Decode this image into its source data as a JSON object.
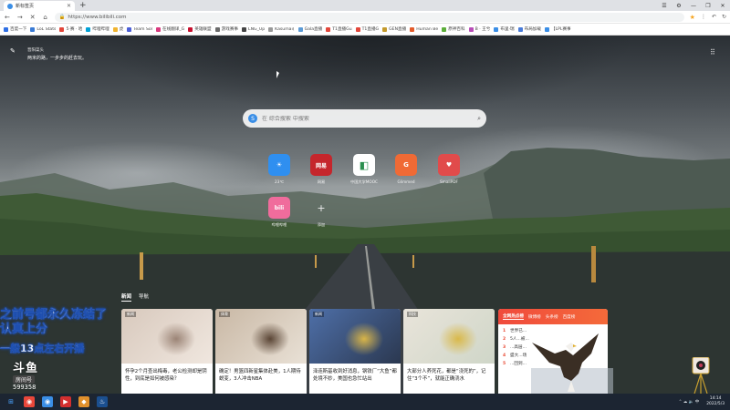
{
  "browser": {
    "tab_title": "新标签页",
    "new_tab_symbol": "+",
    "url": "https://www.bilibili.com",
    "window_controls": [
      "☰",
      "⚙",
      "—",
      "❐",
      "✕"
    ],
    "bookmarks": [
      {
        "label": "百度一下",
        "color": "#2f6fe4"
      },
      {
        "label": "LoL Stats",
        "color": "#3a7bd5"
      },
      {
        "label": "5·赛 · 哈",
        "color": "#e2463a"
      },
      {
        "label": "哔哩哔哩",
        "color": "#00a1d6"
      },
      {
        "label": "虎",
        "color": "#f0b430"
      },
      {
        "label": "Team Sol",
        "color": "#4c5fd7"
      },
      {
        "label": "在线翻译_G",
        "color": "#d93a7e"
      },
      {
        "label": "英雄联盟",
        "color": "#c8102e"
      },
      {
        "label": "游戏赛事",
        "color": "#6b6b6b"
      },
      {
        "label": "LNG_Up",
        "color": "#444"
      },
      {
        "label": "Kasumai(",
        "color": "#999"
      },
      {
        "label": "Gala直播",
        "color": "#5c9bd6"
      },
      {
        "label": "T1直播Gu",
        "color": "#e2463a"
      },
      {
        "label": "T1直播G",
        "color": "#e2463a"
      },
      {
        "label": "GEN直播",
        "color": "#c49a2c"
      },
      {
        "label": "Human Be",
        "color": "#e35b2b"
      },
      {
        "label": "原神百科",
        "color": "#5cae3a"
      },
      {
        "label": "B · 王兮",
        "color": "#b84db8"
      },
      {
        "label": "布里·瑞",
        "color": "#3a8ee6"
      },
      {
        "label": "布局加载",
        "color": "#4a7cd9"
      },
      {
        "label": "【LPL赛事",
        "color": "#3a8ee6"
      }
    ]
  },
  "weather": {
    "title": "晋阳菜头",
    "subtitle": "两米的路，一步步的赶去玩。"
  },
  "search": {
    "placeholder": "在 综合搜索 中搜索"
  },
  "shortcuts": [
    {
      "label": "23℃",
      "glyph": "☀",
      "color": "#2f8ff0"
    },
    {
      "label": "网易",
      "glyph": "网易",
      "color": "#c5262c"
    },
    {
      "label": "中国大学MOOC",
      "glyph": "◧",
      "color": "#ffffff"
    },
    {
      "label": "Glimmed",
      "glyph": "G",
      "color": "#f06a35"
    },
    {
      "label": "SmallPDF",
      "glyph": "♥",
      "color": "#e14b4b"
    },
    {
      "label": "哔哩哔哩",
      "glyph": "bili",
      "color": "#f06c9c"
    },
    {
      "label": "添加",
      "glyph": "+",
      "color": "transparent"
    }
  ],
  "news": {
    "tabs": [
      "新闻",
      "导航"
    ],
    "cards": [
      {
        "tag": "新闻",
        "title": "怀孕2个月查出梅毒，老公检测却是阴性，到底是如何被感染？",
        "palette": [
          "#d8c9bd",
          "#9b8476",
          "#f0e7df"
        ]
      },
      {
        "tag": "体育",
        "title": "确定！男篮四新星集体赴美，1人期待蜕变，3人冲击NBA",
        "palette": [
          "#c9b8a5",
          "#5a4535",
          "#e9e1d6"
        ]
      },
      {
        "tag": "新闻",
        "title": "泽连斯基收到好消息，钢铁厂“大鱼”都处境不妙，美国也急忙站出",
        "palette": [
          "#4e6fa8",
          "#d9b548",
          "#2b3850"
        ]
      },
      {
        "tag": "科技",
        "title": "大部分人养死花，都是“浇死的”，记住“3个不”，就能正确浇水",
        "palette": [
          "#e9e4da",
          "#d9b94a",
          "#cfd6c8"
        ]
      }
    ],
    "hot": {
      "tabs": [
        "全网热点榜",
        "微博榜",
        "头条榜",
        "百度榜"
      ],
      "items": [
        {
          "rank": "1",
          "text": "世界已..."
        },
        {
          "rank": "2",
          "text": "5人...被..."
        },
        {
          "rank": "3",
          "text": "...高层..."
        },
        {
          "rank": "4",
          "text": "盛大...场"
        },
        {
          "rank": "5",
          "text": "...回到..."
        }
      ]
    }
  },
  "overlay": {
    "line1": "之前号都永久冻结了",
    "line2": "认真上分",
    "line3": "一般13点左右开播",
    "brand": "斗鱼",
    "room_label": "房间号",
    "room_number": "599358"
  },
  "taskbar": {
    "apps": [
      {
        "glyph": "⊞",
        "color": "transparent"
      },
      {
        "glyph": "◉",
        "color": "#e9473a"
      },
      {
        "glyph": "◉",
        "color": "#3a8ee6"
      },
      {
        "glyph": "▶",
        "color": "#d22f2f"
      },
      {
        "glyph": "◆",
        "color": "#e0902c"
      },
      {
        "glyph": "♨",
        "color": "#1b4f8f"
      }
    ],
    "tray_text": "⌃ ☁ 🔈 中",
    "time": "14:14",
    "date": "2022/5/3"
  }
}
